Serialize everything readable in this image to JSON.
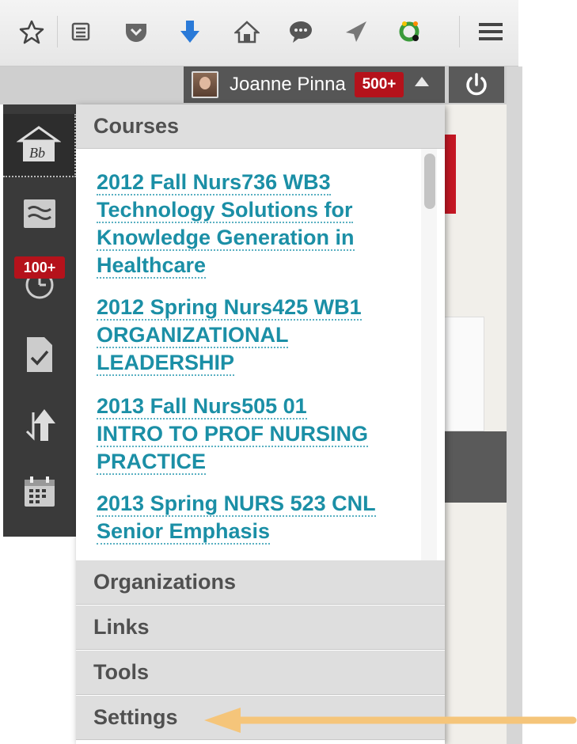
{
  "browser_toolbar": {
    "icons": [
      "star-icon",
      "reading-list-icon",
      "pocket-icon",
      "download-icon",
      "home-icon",
      "chat-icon",
      "send-icon",
      "extension-icon",
      "menu-icon"
    ]
  },
  "user_menu": {
    "name": "Joanne Pinna",
    "notification_count": "500+"
  },
  "left_nav": {
    "items": [
      "blackboard-home-icon",
      "stream-icon",
      "updates-icon",
      "grades-icon",
      "sort-icon",
      "calendar-icon"
    ],
    "updates_badge": "100+"
  },
  "dropdown": {
    "courses_header": "Courses",
    "courses": [
      {
        "lines": [
          "2012 Fall Nurs736 WB3",
          "Technology Solutions for",
          "Knowledge Generation in",
          "Healthcare"
        ]
      },
      {
        "lines": [
          "2012 Spring Nurs425 WB1",
          "ORGANIZATIONAL",
          "LEADERSHIP"
        ]
      },
      {
        "lines": [
          "2013 Fall Nurs505 01",
          "INTRO TO PROF NURSING",
          "PRACTICE"
        ]
      },
      {
        "lines": [
          "2013 Spring NURS 523 CNL",
          "Senior Emphasis"
        ]
      }
    ],
    "sections": [
      "Organizations",
      "Links",
      "Tools",
      "Settings"
    ]
  },
  "colors": {
    "link": "#1b8fa6",
    "badge": "#b5121b",
    "annotation_arrow": "#f5c57a"
  }
}
